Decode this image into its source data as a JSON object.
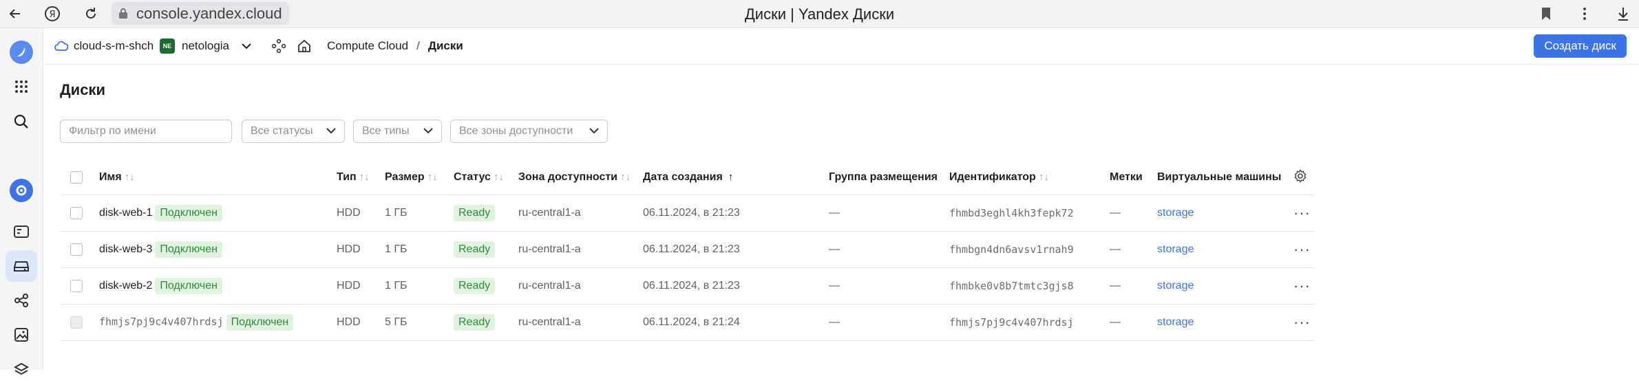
{
  "browser": {
    "url": "console.yandex.cloud",
    "page_title": "Диски | Yandex Диски"
  },
  "header": {
    "cloud": "cloud-s-m-shch",
    "folder_badge": "NE",
    "folder": "netologia",
    "breadcrumb": [
      "Compute Cloud",
      "/",
      "Диски"
    ],
    "create_button": "Создать диск"
  },
  "page": {
    "title": "Диски",
    "filters": {
      "name_placeholder": "Фильтр по имени",
      "status": "Все статусы",
      "type": "Все типы",
      "zone": "Все зоны доступности"
    }
  },
  "table": {
    "columns": [
      "Имя",
      "Тип",
      "Размер",
      "Статус",
      "Зона доступности",
      "Дата создания",
      "Группа размещения",
      "Идентификатор",
      "Метки",
      "Виртуальные машины"
    ],
    "rows": [
      {
        "name": "disk-web-1",
        "attached": "Подключен",
        "type": "HDD",
        "size": "1 ГБ",
        "status": "Ready",
        "zone": "ru-central1-a",
        "created": "06.11.2024, в 21:23",
        "group": "—",
        "id": "fhmbd3eghl4kh3fepk72",
        "labels": "—",
        "vm": "storage"
      },
      {
        "name": "disk-web-3",
        "attached": "Подключен",
        "type": "HDD",
        "size": "1 ГБ",
        "status": "Ready",
        "zone": "ru-central1-a",
        "created": "06.11.2024, в 21:23",
        "group": "—",
        "id": "fhmbgn4dn6avsv1rnah9",
        "labels": "—",
        "vm": "storage"
      },
      {
        "name": "disk-web-2",
        "attached": "Подключен",
        "type": "HDD",
        "size": "1 ГБ",
        "status": "Ready",
        "zone": "ru-central1-a",
        "created": "06.11.2024, в 21:23",
        "group": "—",
        "id": "fhmbke0v8b7tmtc3gjs8",
        "labels": "—",
        "vm": "storage"
      },
      {
        "name": "fhmjs7pj9c4v407hrdsj",
        "attached": "Подключен",
        "type": "HDD",
        "size": "5 ГБ",
        "status": "Ready",
        "zone": "ru-central1-a",
        "created": "06.11.2024, в 21:24",
        "group": "—",
        "id": "fhmjs7pj9c4v407hrdsj",
        "labels": "—",
        "vm": "storage"
      }
    ]
  },
  "colors": {
    "accent": "#3c74e6",
    "ready_bg": "#dff3df",
    "ready_text": "#2f8a3c"
  }
}
